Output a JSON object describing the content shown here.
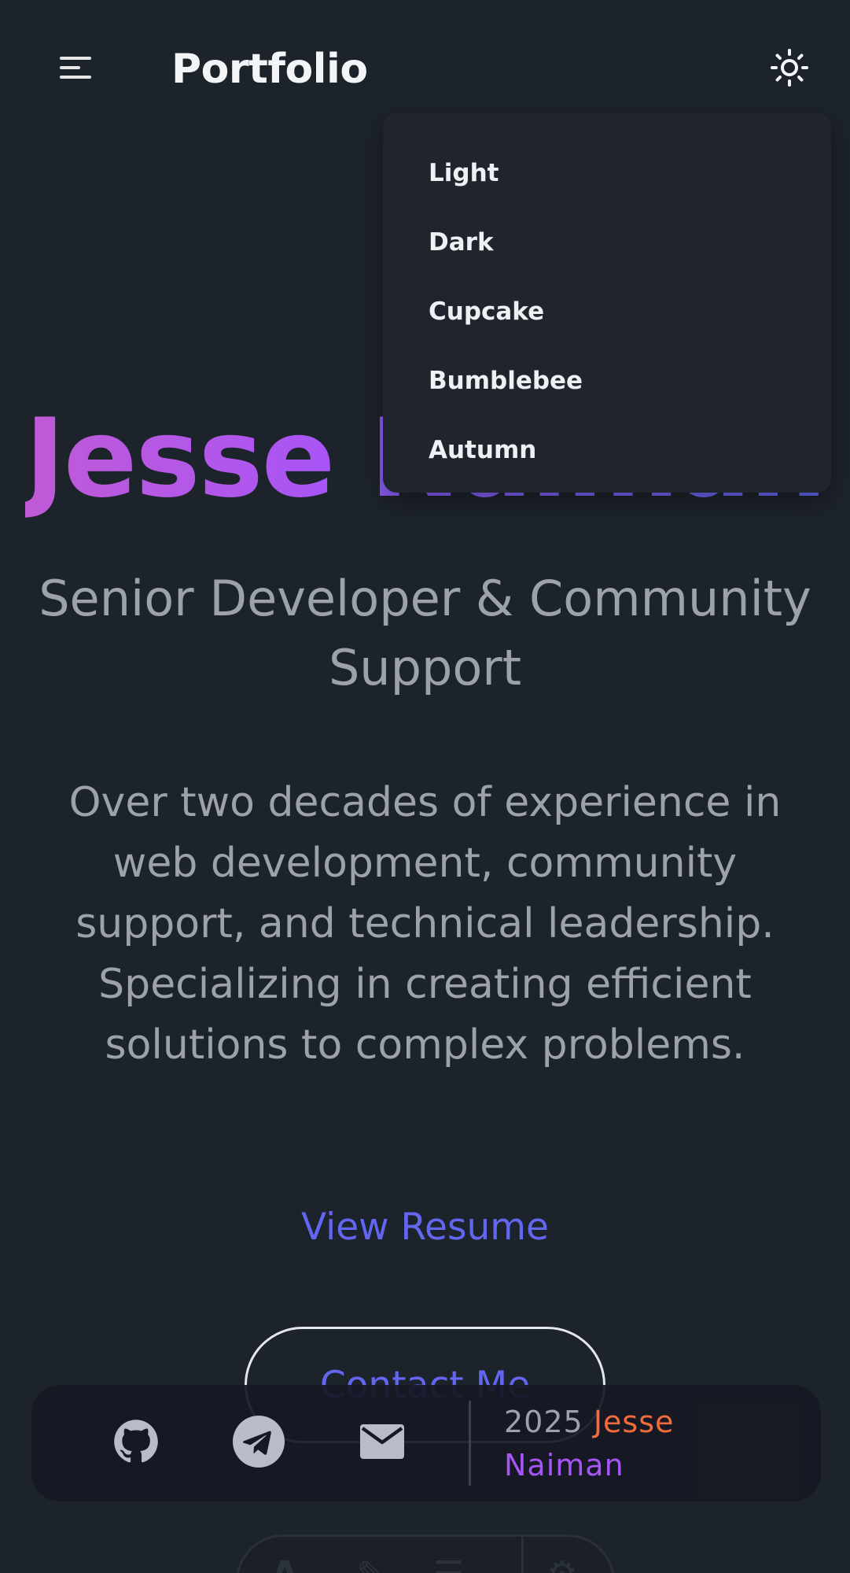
{
  "navbar": {
    "brand": "Portfolio",
    "menu_icon": "hamburger-menu-icon",
    "theme_icon": "sun-icon"
  },
  "theme_dropdown": {
    "items": [
      "Light",
      "Dark",
      "Cupcake",
      "Bumblebee",
      "Autumn"
    ]
  },
  "hero": {
    "first_name": "Jesse",
    "last_name": "Naiman",
    "title_line1": "Senior Developer & Community",
    "title_line2": "Support",
    "description_lines": [
      "Over two decades of experience in",
      "web development, community",
      "support, and technical leadership.",
      "Specializing in creating efficient",
      "solutions to complex problems."
    ],
    "resume_label": "View Resume",
    "contact_label": "Contact Me"
  },
  "footer": {
    "icons": [
      "github-icon",
      "telegram-icon",
      "mail-icon"
    ],
    "year": "2025",
    "first_name": "Jesse",
    "last_name": "Naiman"
  },
  "colors": {
    "background": "#1d232a",
    "accent": "#6366f1",
    "gradient_start": "#c05ad6",
    "gradient_end": "#6366f1",
    "footer_first_name": "#f26b3a",
    "footer_last_name": "#a855f7"
  }
}
